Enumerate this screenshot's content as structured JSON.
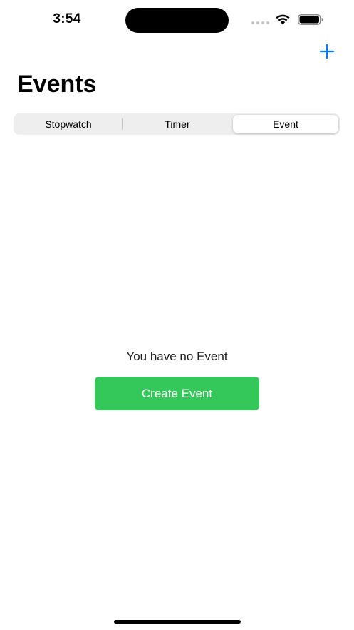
{
  "status_bar": {
    "time": "3:54"
  },
  "nav": {
    "title": "Events",
    "add_icon": "plus-icon"
  },
  "segmented_control": {
    "segments": [
      {
        "label": "Stopwatch",
        "selected": false
      },
      {
        "label": "Timer",
        "selected": false
      },
      {
        "label": "Event",
        "selected": true
      }
    ]
  },
  "empty_state": {
    "message": "You have no Event",
    "button_label": "Create Event"
  },
  "colors": {
    "accent": "#007aff",
    "button_green": "#34c759",
    "segment_bg": "#eeeeef"
  }
}
